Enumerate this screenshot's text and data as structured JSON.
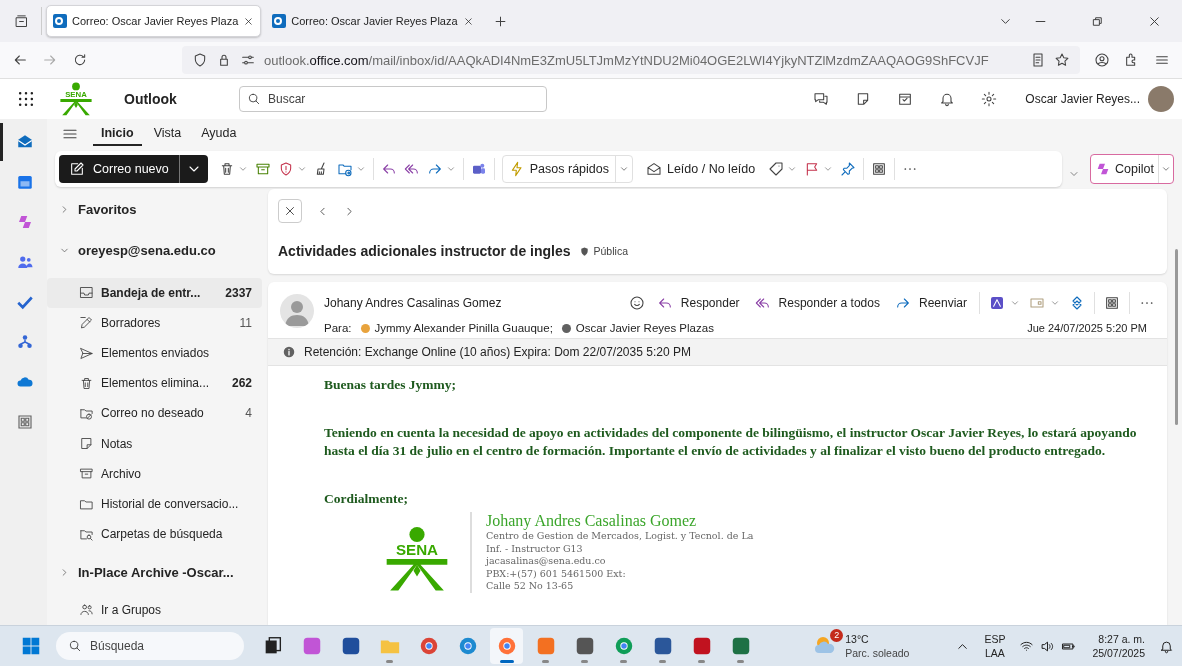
{
  "browser": {
    "tabs": [
      {
        "title": "Correo: Oscar Javier Reyes Plaza",
        "selected": true
      },
      {
        "title": "Correo: Oscar Javier Reyes Plaza",
        "selected": false
      }
    ],
    "url": {
      "prefix": "outlook.",
      "domain": "office.com",
      "path": "/mail/inbox/id/AAQkADI4NmE3ZmU5LTJmMzYtNDU2Mi04OGE2LWI4YjkyNTZlMzdmZAAQAOG9ShFCVJF"
    }
  },
  "app_header": {
    "logo_text": "SENA",
    "app_name": "Outlook",
    "search": {
      "placeholder": "Buscar"
    },
    "user_name": "Oscar Javier Reyes..."
  },
  "nav_rail": [
    {
      "selected": true
    },
    {
      "selected": false
    },
    {
      "selected": false
    },
    {
      "selected": false
    },
    {
      "selected": false
    },
    {
      "selected": false
    },
    {
      "selected": false
    },
    {
      "selected": false
    }
  ],
  "ribbon": {
    "tabs": [
      {
        "label": "Inicio",
        "selected": true
      },
      {
        "label": "Vista",
        "selected": false
      },
      {
        "label": "Ayuda",
        "selected": false
      }
    ],
    "new_mail": "Correo nuevo",
    "quick_steps": "Pasos rápidos",
    "read_unread": "Leído / No leído",
    "copilot": "Copilot"
  },
  "folders": {
    "favorites": {
      "label": "Favoritos",
      "expanded": false
    },
    "account": {
      "label": "oreyesp@sena.edu.co",
      "expanded": true
    },
    "items": [
      {
        "name": "Bandeja de entr...",
        "count": "2337",
        "selected": true,
        "unread": true
      },
      {
        "name": "Borradores",
        "count": "11",
        "selected": false,
        "unread": false
      },
      {
        "name": "Elementos enviados",
        "selected": false
      },
      {
        "name": "Elementos elimina...",
        "count": "262",
        "selected": false,
        "unread": true
      },
      {
        "name": "Correo no deseado",
        "count": "4",
        "selected": false,
        "unread": false
      },
      {
        "name": "Notas",
        "selected": false
      },
      {
        "name": "Archivo",
        "selected": false
      },
      {
        "name": "Historial de conversacio...",
        "selected": false
      },
      {
        "name": "Carpetas de búsqueda",
        "selected": false
      }
    ],
    "archive": {
      "label": "In-Place Archive -Oscar...",
      "expanded": false
    },
    "groups": "Ir a Grupos"
  },
  "message": {
    "subject": "Actividades adicionales instructor de ingles",
    "sensitivity": "Pública",
    "sender": "Johany Andres Casalinas Gomez",
    "to_label": "Para:",
    "recipients": [
      {
        "name": "Jymmy Alexander Pinilla Guauque;",
        "color": "#e8a33d"
      },
      {
        "name": "Oscar Javier Reyes Plazas",
        "color": "#616161"
      }
    ],
    "actions": [
      "Responder",
      "Responder a todos",
      "Reenviar"
    ],
    "date": "Jue 24/07/2025 5:20 PM",
    "retention": "Retención: Exchange Online (10 años) Expira: Dom 22/07/2035 5:20 PM",
    "body": [
      "Buenas tardes Jymmy;",
      "Teniendo en cuenta la necesidad de apoyo en actividades del componente de bilingüismo, el instructor Oscar Javier Reyes, lo estará apoyando hasta el día 31 de julio en el centro de formación. Importante el envío de actividades y al finalizar el visto bueno del producto entregado.",
      "Cordialmente;"
    ],
    "signature": {
      "logo_text": "SENA",
      "name": "Johany Andres Casalinas Gomez",
      "lines": [
        "Centro de Gestion de Mercados, Logist. y Tecnol. de La",
        "Inf. - Instructor G13",
        "jacasalinas@sena.edu.co",
        "PBX:+(57) 601 5461500 Ext:",
        "Calle 52 No 13-65"
      ]
    }
  },
  "taskbar": {
    "search": {
      "placeholder": "Búsqueda"
    },
    "apps": [
      {
        "running": false,
        "selected": false
      },
      {
        "running": false,
        "selected": false
      },
      {
        "running": false,
        "selected": false
      },
      {
        "running": true,
        "selected": false
      },
      {
        "running": false,
        "selected": false
      },
      {
        "running": false,
        "selected": false
      },
      {
        "running": true,
        "selected": true
      },
      {
        "running": true,
        "selected": false
      },
      {
        "running": true,
        "selected": false
      },
      {
        "running": true,
        "selected": false
      },
      {
        "running": true,
        "selected": false
      },
      {
        "running": true,
        "selected": false
      },
      {
        "running": true,
        "selected": false
      }
    ],
    "weather": {
      "badge": "2",
      "temperature": "13°C",
      "condition": "Parc. soleado"
    },
    "language": "ESP",
    "region": "LAA",
    "time": "8:27 a. m.",
    "date": "25/07/2025"
  }
}
